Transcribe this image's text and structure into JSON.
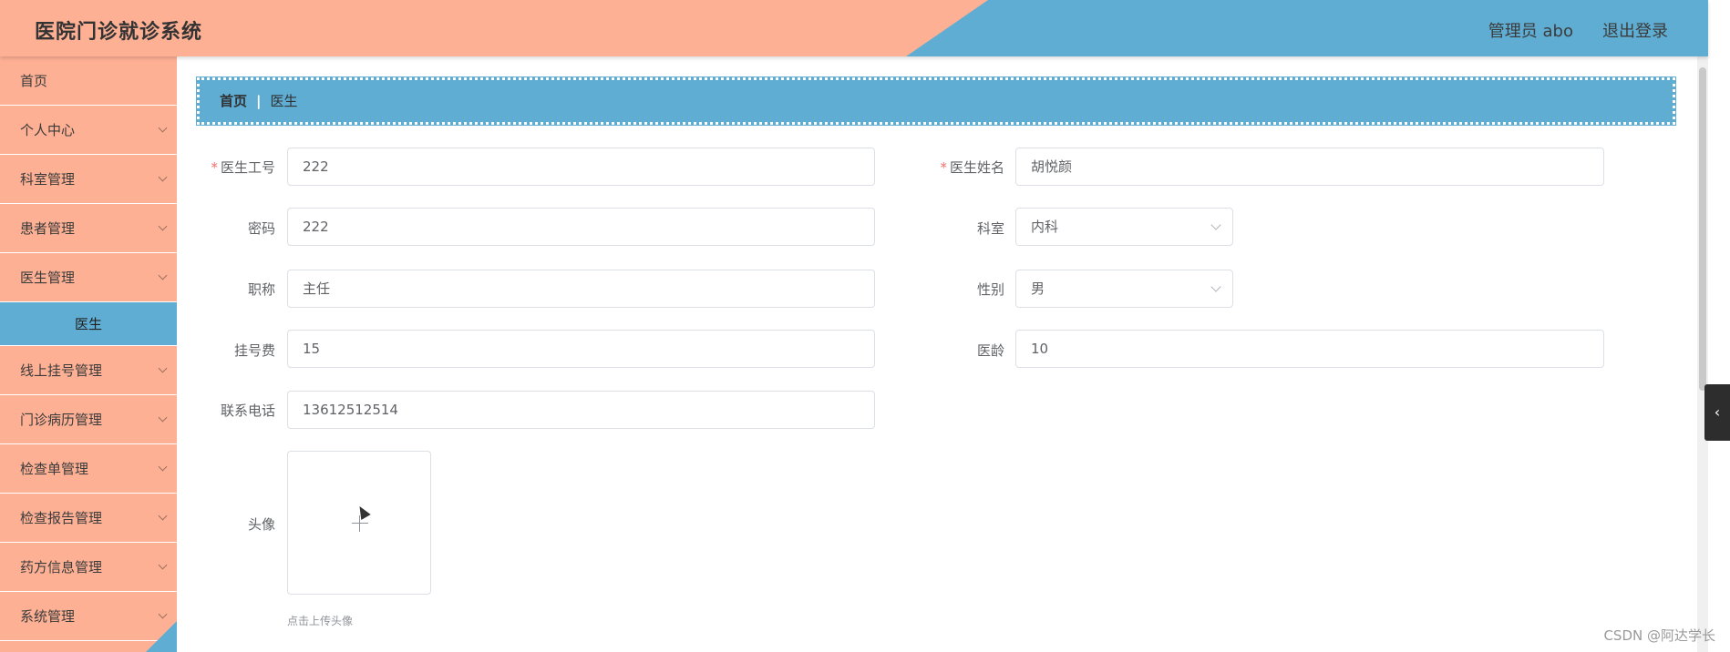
{
  "header": {
    "title": "医院门诊就诊系统",
    "user": "管理员 abo",
    "logout": "退出登录"
  },
  "sidebar": {
    "items": [
      {
        "label": "首页"
      },
      {
        "label": "个人中心"
      },
      {
        "label": "科室管理"
      },
      {
        "label": "患者管理"
      },
      {
        "label": "医生管理"
      },
      {
        "label": "医生"
      },
      {
        "label": "线上挂号管理"
      },
      {
        "label": "门诊病历管理"
      },
      {
        "label": "检查单管理"
      },
      {
        "label": "检查报告管理"
      },
      {
        "label": "药方信息管理"
      },
      {
        "label": "系统管理"
      }
    ]
  },
  "breadcrumb": {
    "home": "首页",
    "separator": "|",
    "current": "医生"
  },
  "form": {
    "doctor_id": {
      "label": "医生工号",
      "value": "222"
    },
    "doctor_name": {
      "label": "医生姓名",
      "value": "胡悦颜"
    },
    "password": {
      "label": "密码",
      "value": "222"
    },
    "department": {
      "label": "科室",
      "value": "内科"
    },
    "title": {
      "label": "职称",
      "value": "主任"
    },
    "gender": {
      "label": "性别",
      "value": "男"
    },
    "fee": {
      "label": "挂号费",
      "value": "15"
    },
    "years": {
      "label": "医龄",
      "value": "10"
    },
    "phone": {
      "label": "联系电话",
      "value": "13612512514"
    },
    "avatar": {
      "label": "头像",
      "tip": "点击上传头像"
    }
  },
  "watermark": "CSDN @阿达学长",
  "side_toggle": "‹",
  "colors": {
    "salmon": "#fdb094",
    "blue": "#5fadd3",
    "required": "#f56c6c"
  }
}
